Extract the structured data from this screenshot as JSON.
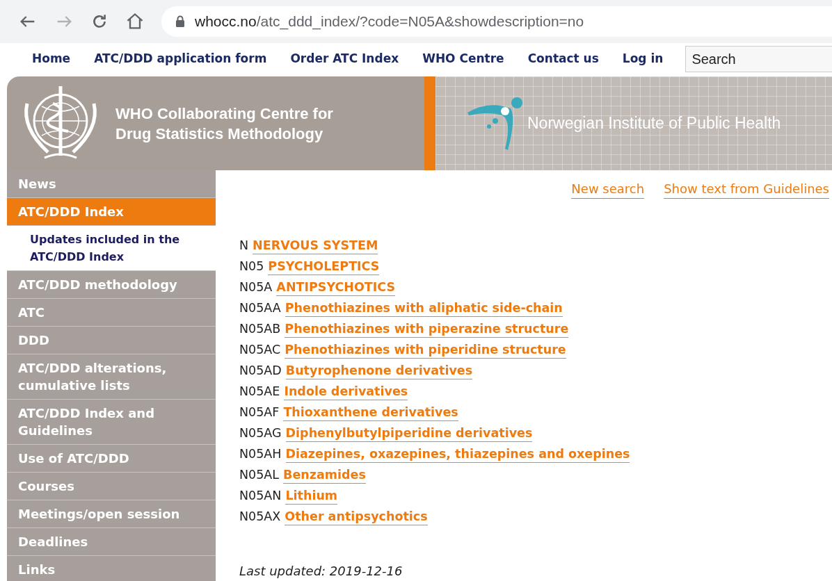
{
  "browser": {
    "url_host": "whocc.no",
    "url_path": "/atc_ddd_index/?code=N05A&showdescription=no"
  },
  "top_nav": {
    "links": [
      "Home",
      "ATC/DDD application form",
      "Order ATC Index",
      "WHO Centre",
      "Contact us",
      "Log in"
    ],
    "search": {
      "placeholder": "Search"
    }
  },
  "header": {
    "title_lines": [
      "WHO Collaborating Centre for",
      "Drug Statistics Methodology"
    ],
    "partner": "Norwegian Institute of Public Health"
  },
  "sidebar": {
    "items": [
      {
        "label": "News",
        "selected": false
      },
      {
        "label": "ATC/DDD Index",
        "selected": true,
        "children": [
          {
            "label": "Updates included in the ATC/DDD Index"
          }
        ]
      },
      {
        "label": "ATC/DDD methodology",
        "selected": false
      },
      {
        "label": "ATC",
        "selected": false
      },
      {
        "label": "DDD",
        "selected": false
      },
      {
        "label": "ATC/DDD alterations, cumulative lists",
        "selected": false
      },
      {
        "label": "ATC/DDD Index and Guidelines",
        "selected": false
      },
      {
        "label": "Use of ATC/DDD",
        "selected": false
      },
      {
        "label": "Courses",
        "selected": false
      },
      {
        "label": "Meetings/open session",
        "selected": false
      },
      {
        "label": "Deadlines",
        "selected": false
      },
      {
        "label": "Links",
        "selected": false
      }
    ]
  },
  "content": {
    "actions": [
      "New search",
      "Show text from Guidelines"
    ],
    "codes": [
      {
        "code": "N",
        "name": "NERVOUS SYSTEM"
      },
      {
        "code": "N05",
        "name": "PSYCHOLEPTICS"
      },
      {
        "code": "N05A",
        "name": "ANTIPSYCHOTICS"
      },
      {
        "code": "N05AA",
        "name": "Phenothiazines with aliphatic side-chain"
      },
      {
        "code": "N05AB",
        "name": "Phenothiazines with piperazine structure"
      },
      {
        "code": "N05AC",
        "name": "Phenothiazines with piperidine structure"
      },
      {
        "code": "N05AD",
        "name": "Butyrophenone derivatives"
      },
      {
        "code": "N05AE",
        "name": "Indole derivatives"
      },
      {
        "code": "N05AF",
        "name": "Thioxanthene derivatives"
      },
      {
        "code": "N05AG",
        "name": "Diphenylbutylpiperidine derivatives"
      },
      {
        "code": "N05AH",
        "name": "Diazepines, oxazepines, thiazepines and oxepines"
      },
      {
        "code": "N05AL",
        "name": "Benzamides"
      },
      {
        "code": "N05AN",
        "name": "Lithium"
      },
      {
        "code": "N05AX",
        "name": "Other antipsychotics"
      }
    ],
    "last_updated": "Last updated: 2019-12-16"
  }
}
